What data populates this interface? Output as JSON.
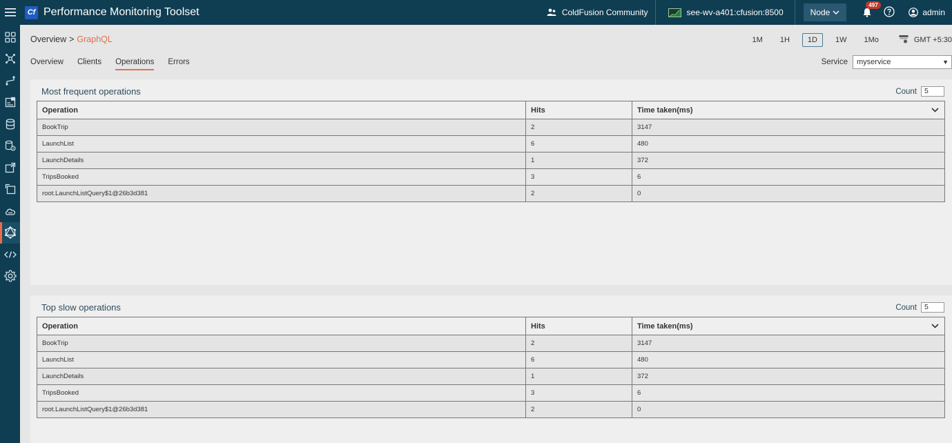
{
  "header": {
    "logo": "Cf",
    "title": "Performance Monitoring Toolset",
    "community": "ColdFusion Community",
    "server": "see-wv-a401:cfusion:8500",
    "node": "Node",
    "notifications": "497",
    "user": "admin"
  },
  "breadcrumb": {
    "root": "Overview",
    "separator": ">",
    "current": "GraphQL"
  },
  "tabs": [
    "Overview",
    "Clients",
    "Operations",
    "Errors"
  ],
  "time_range": {
    "options": [
      "1M",
      "1H",
      "1D",
      "1W",
      "1Mo"
    ],
    "selected": "1D",
    "timezone": "GMT +5:30"
  },
  "service": {
    "label": "Service",
    "value": "myservice"
  },
  "columns": [
    "Operation",
    "Hits",
    "Time taken(ms)"
  ],
  "count_label": "Count",
  "frequent": {
    "title": "Most frequent operations",
    "count": "5",
    "rows": [
      [
        "BookTrip",
        "2",
        "3147"
      ],
      [
        "LaunchList",
        "6",
        "480"
      ],
      [
        "LaunchDetails",
        "1",
        "372"
      ],
      [
        "TripsBooked",
        "3",
        "6"
      ],
      [
        "root.LaunchListQuery$1@26b3d381",
        "2",
        "0"
      ]
    ]
  },
  "slow": {
    "title": "Top slow operations",
    "count": "5",
    "rows": [
      [
        "BookTrip",
        "2",
        "3147"
      ],
      [
        "LaunchList",
        "6",
        "480"
      ],
      [
        "LaunchDetails",
        "1",
        "372"
      ],
      [
        "TripsBooked",
        "3",
        "6"
      ],
      [
        "root.LaunchListQuery$1@26b3d381",
        "2",
        "0"
      ]
    ]
  },
  "sidebar": {
    "icons": [
      "dashboard-icon",
      "topology-icon",
      "routes-icon",
      "cf-report-icon",
      "database-icon",
      "datasource-icon",
      "external-icon",
      "export-icon",
      "cloud-icon",
      "graphql-icon",
      "code-icon",
      "settings-icon"
    ],
    "active": "graphql-icon"
  },
  "colors": {
    "topbar": "#0f3d52",
    "accent": "#e2704f",
    "badge": "#c0392b"
  }
}
